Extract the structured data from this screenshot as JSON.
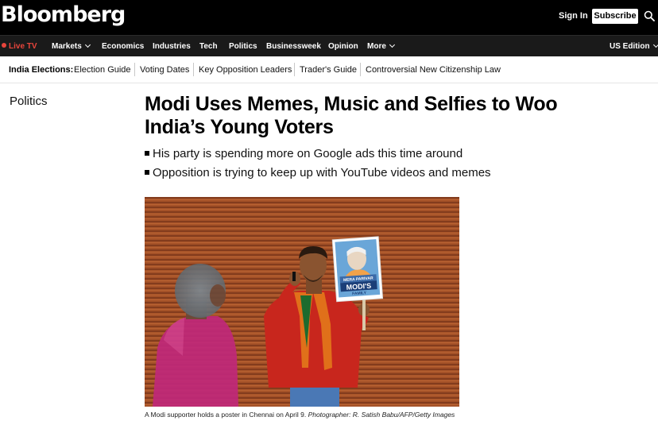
{
  "header": {
    "logo": "Bloomberg",
    "sign_in": "Sign In",
    "subscribe": "Subscribe",
    "search_icon": "search-icon"
  },
  "nav": {
    "live_tv": "Live TV",
    "items": [
      "Markets",
      "Economics",
      "Industries",
      "Tech",
      "Politics",
      "Businessweek",
      "Opinion",
      "More"
    ],
    "edition": "US Edition"
  },
  "subnav": {
    "label": "India Elections:",
    "links": [
      "Election Guide",
      "Voting Dates",
      "Key Opposition Leaders",
      "Trader's Guide",
      "Controversial New Citizenship Law"
    ]
  },
  "article": {
    "section": "Politics",
    "headline": "Modi Uses Memes, Music and Selfies to Woo India’s Young Voters",
    "bullets": [
      "His party is spending more on Google ads this time around",
      "Opposition is trying to keep up with YouTube videos and memes"
    ],
    "photo": {
      "poster_top": "MERA PARIVAR",
      "poster_main": "MODI'S",
      "poster_bottom": "FAMILY"
    },
    "caption": "A Modi supporter holds a poster in Chennai on April 9.",
    "credit": "Photographer: R. Satish Babu/AFP/Getty Images"
  },
  "colors": {
    "live_red": "#e8453c",
    "shutter_orange": "#b45a2c",
    "shirt_red": "#c8261d",
    "shirt_pink": "#c0287a"
  }
}
